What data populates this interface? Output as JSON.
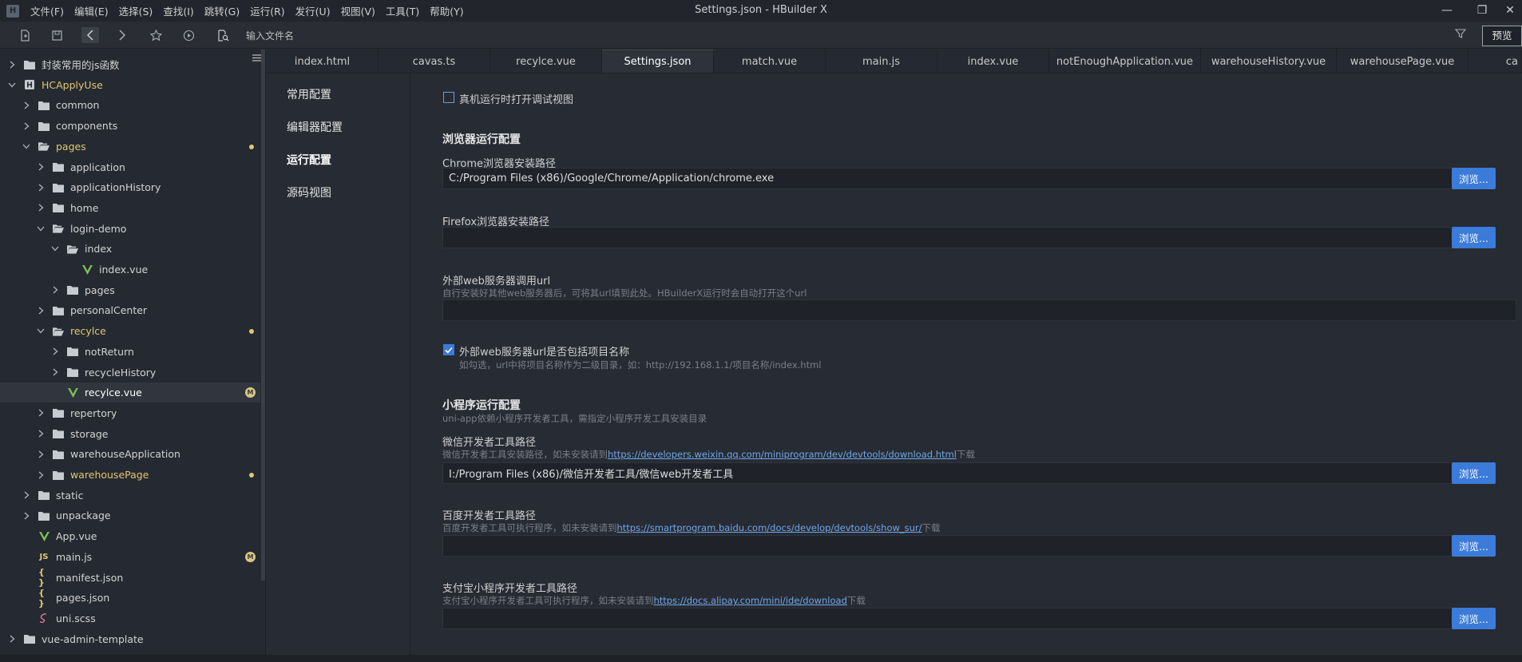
{
  "window": {
    "title": "Settings.json - HBuilder X",
    "logo_glyph": "H",
    "minimize_glyph": "—",
    "restore_glyph": "❐",
    "close_glyph": "✕"
  },
  "menu": [
    "文件(F)",
    "编辑(E)",
    "选择(S)",
    "查找(I)",
    "跳转(G)",
    "运行(R)",
    "发行(U)",
    "视图(V)",
    "工具(T)",
    "帮助(Y)"
  ],
  "toolbar": {
    "file_search_placeholder": "输入文件名",
    "preview_label": "预览",
    "icons": [
      "new-file-icon",
      "save-icon",
      "back-icon",
      "forward-icon",
      "star-icon",
      "run-icon",
      "search-file-icon",
      "filter-icon"
    ]
  },
  "sidebar": {
    "items": [
      {
        "label": "封装常用的js函数",
        "kind": "folder-root"
      },
      {
        "label": "HCApplyUse",
        "kind": "project-root"
      },
      {
        "label": "common",
        "kind": "folder"
      },
      {
        "label": "components",
        "kind": "folder"
      },
      {
        "label": "pages",
        "kind": "folder-open"
      },
      {
        "label": "application",
        "kind": "folder"
      },
      {
        "label": "applicationHistory",
        "kind": "folder"
      },
      {
        "label": "home",
        "kind": "folder"
      },
      {
        "label": "login-demo",
        "kind": "folder-open"
      },
      {
        "label": "index",
        "kind": "folder-open"
      },
      {
        "label": "index.vue",
        "kind": "vue"
      },
      {
        "label": "pages",
        "kind": "folder"
      },
      {
        "label": "personalCenter",
        "kind": "folder"
      },
      {
        "label": "recylce",
        "kind": "folder-open"
      },
      {
        "label": "notReturn",
        "kind": "folder"
      },
      {
        "label": "recycleHistory",
        "kind": "folder"
      },
      {
        "label": "recylce.vue",
        "kind": "vue",
        "badge": "M"
      },
      {
        "label": "repertory",
        "kind": "folder"
      },
      {
        "label": "storage",
        "kind": "folder"
      },
      {
        "label": "warehouseApplication",
        "kind": "folder"
      },
      {
        "label": "warehousePage",
        "kind": "folder"
      },
      {
        "label": "static",
        "kind": "folder"
      },
      {
        "label": "unpackage",
        "kind": "folder"
      },
      {
        "label": "App.vue",
        "kind": "vue"
      },
      {
        "label": "main.js",
        "kind": "js",
        "badge": "M",
        "icon_text": "JS"
      },
      {
        "label": "manifest.json",
        "kind": "json",
        "icon_text": "{ }"
      },
      {
        "label": "pages.json",
        "kind": "json",
        "icon_text": "{ }"
      },
      {
        "label": "uni.scss",
        "kind": "scss"
      },
      {
        "label": "vue-admin-template",
        "kind": "folder-root"
      }
    ]
  },
  "tabs": [
    "index.html",
    "cavas.ts",
    "recylce.vue",
    "Settings.json",
    "match.vue",
    "main.js",
    "index.vue",
    "notEnoughApplication.vue",
    "warehouseHistory.vue",
    "warehousePage.vue",
    "ca"
  ],
  "active_tab_index": 3,
  "settings_nav": [
    "常用配置",
    "编辑器配置",
    "运行配置",
    "源码视图"
  ],
  "settings_nav_current_index": 2,
  "settings": {
    "debug_view": {
      "label": "真机运行时打开调试视图",
      "checked": false
    },
    "browser_section": "浏览器运行配置",
    "chrome_path": {
      "label": "Chrome浏览器安装路径",
      "value": "C:/Program Files (x86)/Google/Chrome/Application/chrome.exe",
      "browse": "浏览..."
    },
    "firefox_path": {
      "label": "Firefox浏览器安装路径",
      "value": "",
      "browse": "浏览..."
    },
    "external_web": {
      "label": "外部web服务器调用url",
      "hint": "自行安装好其他web服务器后，可将其url填到此处。HBuilderX运行时会自动打开这个url",
      "value": ""
    },
    "include_project_name": {
      "label": "外部web服务器url是否包括项目名称",
      "checked": true,
      "hint": "如勾选，url中将项目名称作为二级目录，如：http://192.168.1.1/项目名称/index.html"
    },
    "mini_section": "小程序运行配置",
    "mini_section_hint": "uni-app依赖小程序开发者工具，需指定小程序开发工具安装目录",
    "wechat": {
      "label": "微信开发者工具路径",
      "hint_prefix": "微信开发者工具安装路径，如未安装请到",
      "hint_link": "https://developers.weixin.qq.com/miniprogram/dev/devtools/download.html",
      "hint_suffix": "下载",
      "value": "I:/Program Files (x86)/微信开发者工具/微信web开发者工具",
      "browse": "浏览..."
    },
    "baidu": {
      "label": "百度开发者工具路径",
      "hint_prefix": "百度开发者工具可执行程序，如未安装请到",
      "hint_link": "https://smartprogram.baidu.com/docs/develop/devtools/show_sur/",
      "hint_suffix": "下载",
      "value": "",
      "browse": "浏览..."
    },
    "alipay": {
      "label": "支付宝小程序开发者工具路径",
      "hint_prefix": "支付宝小程序开发者工具可执行程序，如未安装请到",
      "hint_link": "https://docs.alipay.com/mini/ide/download",
      "hint_suffix": "下载",
      "value": "",
      "browse": "浏览..."
    }
  },
  "colors": {
    "accent": "#3b7bd9",
    "modified": "#e2c670",
    "vue_green": "#7cc158",
    "link": "#6fa7ea"
  }
}
